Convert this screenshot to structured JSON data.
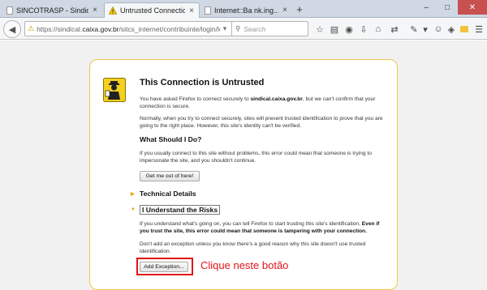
{
  "tabs": [
    {
      "label": "SINCOTRASP - Sindicato das C...",
      "close": "×",
      "icon": "page-icon",
      "active": false
    },
    {
      "label": "Untrusted Connection",
      "close": "×",
      "icon": "warning-icon",
      "active": true
    },
    {
      "label": "Internet::Ba nk.ing....CADIA",
      "close": "×",
      "icon": "page-icon",
      "active": false
    }
  ],
  "new_tab": "+",
  "window_controls": {
    "minimize": "–",
    "maximize": "□",
    "close": "✕"
  },
  "nav": {
    "url_host": "https://sindical.",
    "url_domain": "caixa.gov.br",
    "url_path": "/sitcs_internet/contribuinte/login/login.do",
    "search_placeholder": "Search"
  },
  "page": {
    "title": "This Connection is Untrusted",
    "intro_before": "You have asked Firefox to connect securely to ",
    "intro_host": "sindical.caixa.gov.br",
    "intro_after": ", but we can't confirm that your connection is secure.",
    "normally": "Normally, when you try to connect securely, sites will present trusted identification to prove that you are going to the right place. However, this site's identity can't be verified.",
    "what_heading": "What Should I Do?",
    "what_text": "If you usually connect to this site without problems, this error could mean that someone is trying to impersonate the site, and you shouldn't continue.",
    "get_me_out": "Get me out of here!",
    "technical": "Technical Details",
    "understand": "I Understand the Risks",
    "understand_text_before": "If you understand what's going on, you can tell Firefox to start trusting this site's identification. ",
    "understand_text_bold": "Even if you trust the site, this error could mean that someone is tampering with your connection.",
    "dont_add": "Don't add an exception unless you know there's a good reason why this site doesn't use trusted identification.",
    "add_exception": "Add Exception..."
  },
  "annotation": {
    "callout": "Clique neste botão",
    "color": "#e0141a"
  },
  "colors": {
    "error_border": "#f0c64b",
    "expander_arrow": "#e6a100"
  }
}
